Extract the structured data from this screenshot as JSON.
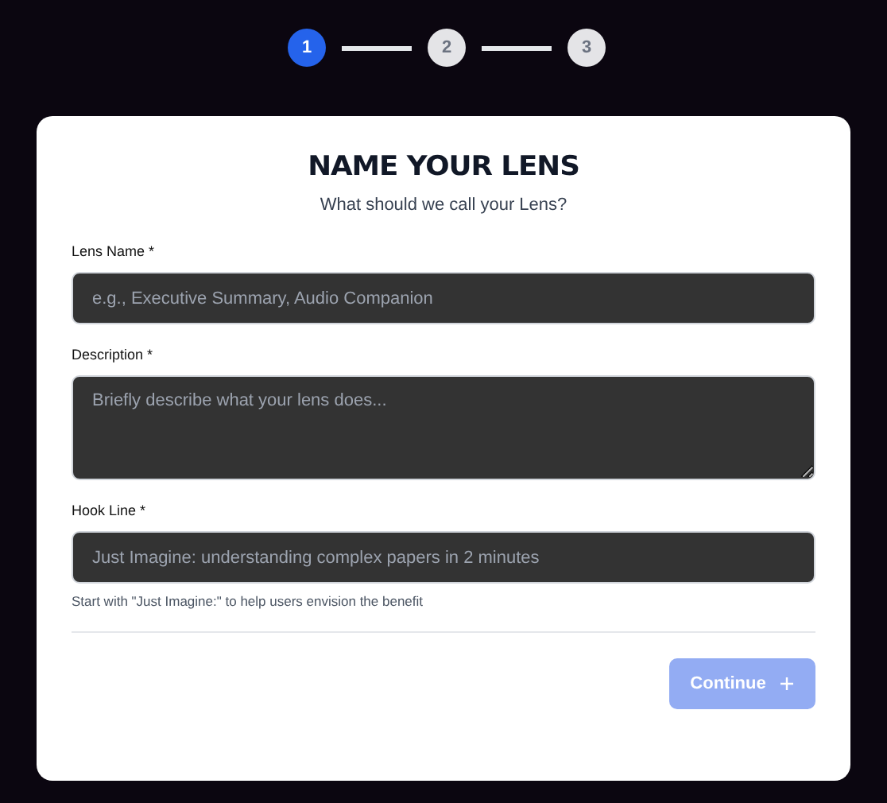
{
  "steps": [
    {
      "label": "1",
      "selected": true
    },
    {
      "label": "2",
      "selected": false
    },
    {
      "label": "3",
      "selected": false
    }
  ],
  "card": {
    "title": "NAME YOUR LENS",
    "subtitle": "What should we call your Lens?",
    "fields": [
      {
        "kind": "input",
        "label": "Lens Name *",
        "placeholder": "e.g., Executive Summary, Audio Companion"
      },
      {
        "kind": "textarea",
        "label": "Description *",
        "placeholder": "Briefly describe what your lens does..."
      },
      {
        "kind": "input",
        "label": "Hook Line *",
        "placeholder": "Just Imagine: understanding complex papers in 2 minutes",
        "hint": "Start with \"Just Imagine:\" to help users envision the benefit"
      }
    ],
    "continue_button": {
      "label": "Continue",
      "disabled": true
    }
  }
}
